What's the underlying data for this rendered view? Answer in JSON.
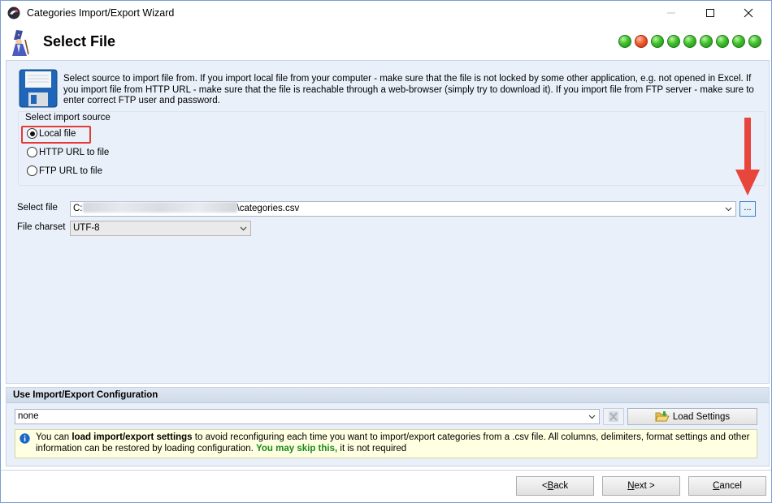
{
  "window": {
    "title": "Categories Import/Export Wizard"
  },
  "header": {
    "title": "Select File",
    "steps": [
      "green",
      "red",
      "green",
      "green",
      "green",
      "green",
      "green",
      "green",
      "green"
    ]
  },
  "info": {
    "text": "Select source to import file from. If you import local file from your computer - make sure that the file is not locked by some other application, e.g. not opened in Excel. If you import file from HTTP URL - make sure that the file is reachable through a web-browser (simply try to download it). If you import file from FTP server - make sure to enter correct FTP user and password."
  },
  "source": {
    "group_title": "Select import source",
    "options": [
      {
        "label": "Local file",
        "checked": true
      },
      {
        "label": "HTTP URL to file",
        "checked": false
      },
      {
        "label": "FTP URL to file",
        "checked": false
      }
    ]
  },
  "file": {
    "label": "Select file",
    "value_prefix": "C:",
    "value_suffix": "\\categories.csv",
    "browse_label": "...",
    "charset_label": "File charset",
    "charset_value": "UTF-8"
  },
  "config": {
    "title": "Use Import/Export Configuration",
    "selected": "none",
    "load_label": "Load Settings",
    "notice_1": "You can ",
    "notice_bold": "load import/export settings",
    "notice_2": " to avoid reconfiguring each time you want to import/export categories from a .csv file. All columns, delimiters, format settings and other information can be restored by loading configuration. ",
    "notice_green": "You may skip this,",
    "notice_3": " it is not required"
  },
  "buttons": {
    "back_pre": "< ",
    "back_u": "B",
    "back_post": "ack",
    "next_u": "N",
    "next_post": "ext >",
    "cancel_u": "C",
    "cancel_post": "ancel"
  },
  "colors": {
    "accent": "#3c7fd0",
    "highlight": "#e53935",
    "panel": "#e9f0f9",
    "notice_bg": "#ffffe1"
  }
}
